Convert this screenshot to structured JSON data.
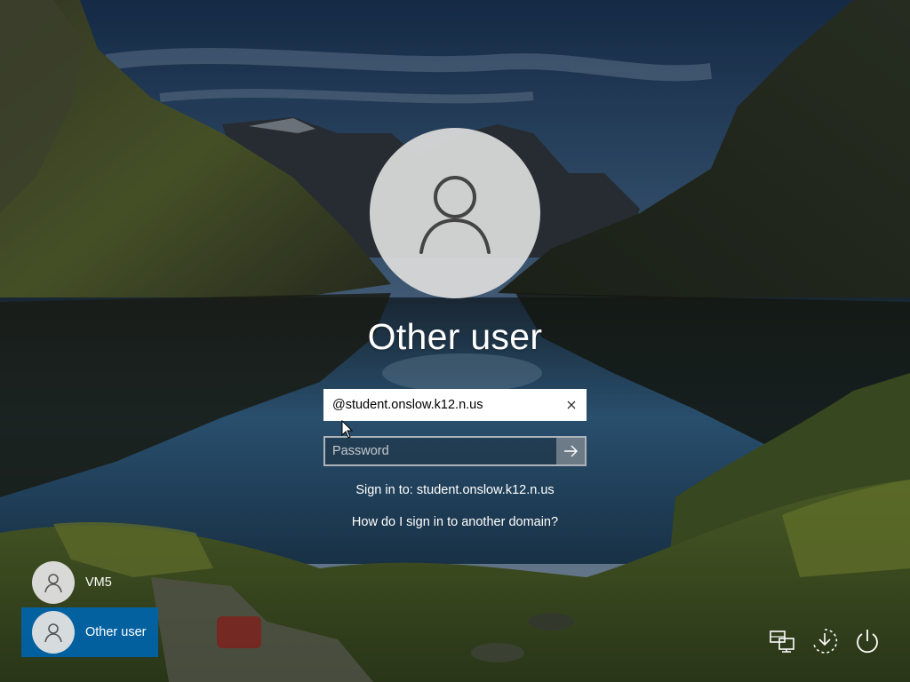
{
  "login": {
    "user_title": "Other user",
    "username_value": "@student.onslow.k12.n.us",
    "password_placeholder": "Password",
    "sign_in_to": "Sign in to: student.onslow.k12.n.us",
    "domain_help": "How do I sign in to another domain?"
  },
  "user_list": [
    {
      "label": "VM5",
      "selected": false
    },
    {
      "label": "Other user",
      "selected": true
    }
  ],
  "corner_icons": [
    "network-icon",
    "accessibility-icon",
    "power-icon"
  ],
  "colors": {
    "selected_tile": "#0064aa",
    "text": "#ffffff"
  }
}
